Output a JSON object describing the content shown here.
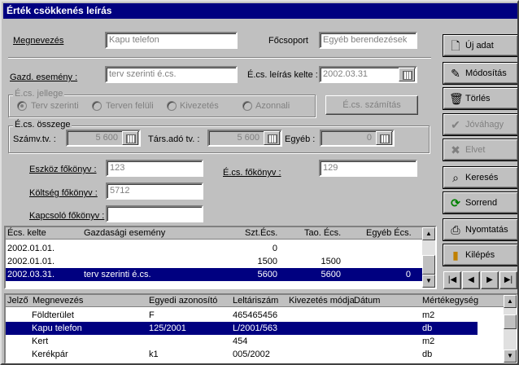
{
  "window": {
    "title": "Érték csökkenés leírás"
  },
  "form": {
    "megnevezes_label": "Megnevezés",
    "megnevezes_value": "Kapu telefon",
    "focsoport_label": "Főcsoport",
    "focsoport_value": "Egyéb berendezések",
    "gazd_esemeny_label": "Gazd. esemény :",
    "gazd_esemeny_value": "terv szerinti é.cs.",
    "ecs_leiras_kelte_label": "É.cs. leírás kelte :",
    "ecs_leiras_kelte_value": "2002.03.31",
    "jelleg_group_title": "É.cs. jellege",
    "radios": [
      "Terv szerinti",
      "Terven felüli",
      "Kivezetés",
      "Azonnali"
    ],
    "ecs_szamitas_button": "É.cs. számítás",
    "osszeg_group_title": "É.cs. összege",
    "szamv_tv_label": "Számv.tv. :",
    "szamv_tv_value": "5 600",
    "tarsado_tv_label": "Társ.adó tv. :",
    "tarsado_tv_value": "5 600",
    "egyeb_label": "Egyéb :",
    "egyeb_value": "0",
    "eszkoz_fokonyv_label": "Eszköz főkönyv :",
    "eszkoz_fokonyv_value": "123",
    "ecs_fokonyv_label": "É.cs. főkönyv :",
    "ecs_fokonyv_value": "129",
    "koltseg_fokonyv_label": "Költség főkönyv :",
    "koltseg_fokonyv_value": "5712",
    "kapcsolo_fokonyv_label": "Kapcsoló főkönyv :",
    "kapcsolo_fokonyv_value": ""
  },
  "buttons": {
    "uj_adat": "Új adat",
    "modositas": "Módosítás",
    "torles": "Törlés",
    "jovahagy": "Jóváhagy",
    "elvet": "Elvet",
    "kereses": "Keresés",
    "sorrend": "Sorrend",
    "nyomtatas": "Nyomtatás",
    "kilepes": "Kilépés"
  },
  "nav": [
    "|◀",
    "◀",
    "▶",
    "▶|"
  ],
  "history_table": {
    "headers": [
      "Écs. kelte",
      "Gazdasági esemény",
      "Szt.Écs.",
      "Tao. Écs.",
      "Egyéb Écs."
    ],
    "rows": [
      [
        "2002.01.01.",
        "",
        "0",
        "",
        ""
      ],
      [
        "2002.01.01.",
        "",
        "1500",
        "1500",
        ""
      ],
      [
        "2002.03.31.",
        "terv szerinti é.cs.",
        "5600",
        "5600",
        "0"
      ]
    ],
    "selected_row": 2
  },
  "asset_table": {
    "headers": [
      "Jelző",
      "Megnevezés",
      "Egyedi azonosító",
      "Leltáriszám",
      "Kivezetés módja",
      "Dátum",
      "Mértékegység"
    ],
    "rows": [
      [
        "",
        "Földterület",
        "F",
        "465465456",
        "",
        "",
        "m2"
      ],
      [
        "",
        "Kapu telefon",
        "125/2001",
        "L/2001/563",
        "",
        "",
        "db"
      ],
      [
        "",
        "Kert",
        "",
        "454",
        "",
        "",
        "m2"
      ],
      [
        "",
        "Kerékpár",
        "k1",
        "005/2002",
        "",
        "",
        "db"
      ]
    ],
    "selected_row": 1
  },
  "colors": {
    "title_bar": "#000080",
    "selection": "#000080",
    "face": "#c0c0c0"
  }
}
